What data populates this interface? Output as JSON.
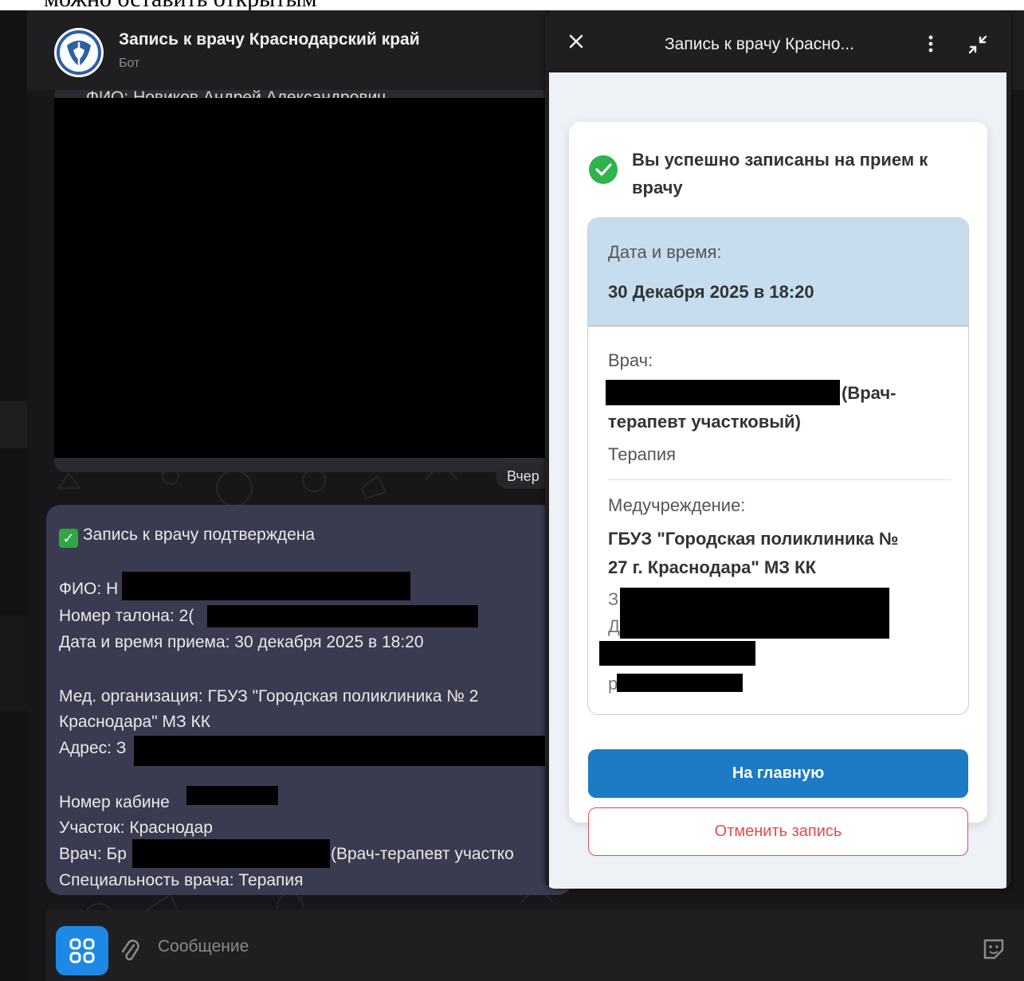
{
  "caption": {
    "text": "можно оставить открытым"
  },
  "chat": {
    "bot_name": "Запись к врачу Краснодарский край",
    "bot_subtitle": "Бот",
    "msg1_cut_text": "ФИО: Новиков Андрей Александрович",
    "time_chip": "Вчер",
    "msg2": {
      "title": "Запись к врачу подтверждена",
      "fio": "ФИО: Н",
      "ticket": "Номер талона: 2(",
      "datetime": "Дата и время приема: 30 декабря 2025 в 18:20",
      "org_line1": "Мед. организация: ГБУЗ \"Городская поликлиника № 2",
      "org_line2": "Краснодара\" МЗ КК",
      "address": "Адрес: З",
      "cabinet": "Номер кабине",
      "area": "Участок: Краснодар",
      "doctor_prefix": "Врач: Бр",
      "doctor_suffix": "(Врач-терапевт участко",
      "specialty": "Специальность врача: Терапия"
    },
    "input_placeholder": "Сообщение"
  },
  "webapp": {
    "title": "Запись к врачу Красно...",
    "success_text": "Вы успешно записаны на прием к врачу",
    "dt_label": "Дата и время:",
    "dt_value": "30 Декабря 2025 в 18:20",
    "doctor_label": "Врач:",
    "doctor_suffix": "(Врач-",
    "doctor_line2": "терапевт участковый)",
    "specialty": "Терапия",
    "org_label": "Медучреждение:",
    "org_line1": "ГБУЗ \"Городская поликлиника №",
    "org_line2": "27 г. Краснодара\" МЗ КК",
    "addr_frag1": "З",
    "addr_frag2": "Д",
    "addr_frag3": "р",
    "btn_main": "На главную",
    "btn_cancel": "Отменить запись"
  },
  "colors": {
    "accent_blue": "#1d7ac4",
    "success_green": "#2eb34d",
    "cancel_red": "#e84a4a",
    "highlight_bg": "#c6dcef"
  }
}
